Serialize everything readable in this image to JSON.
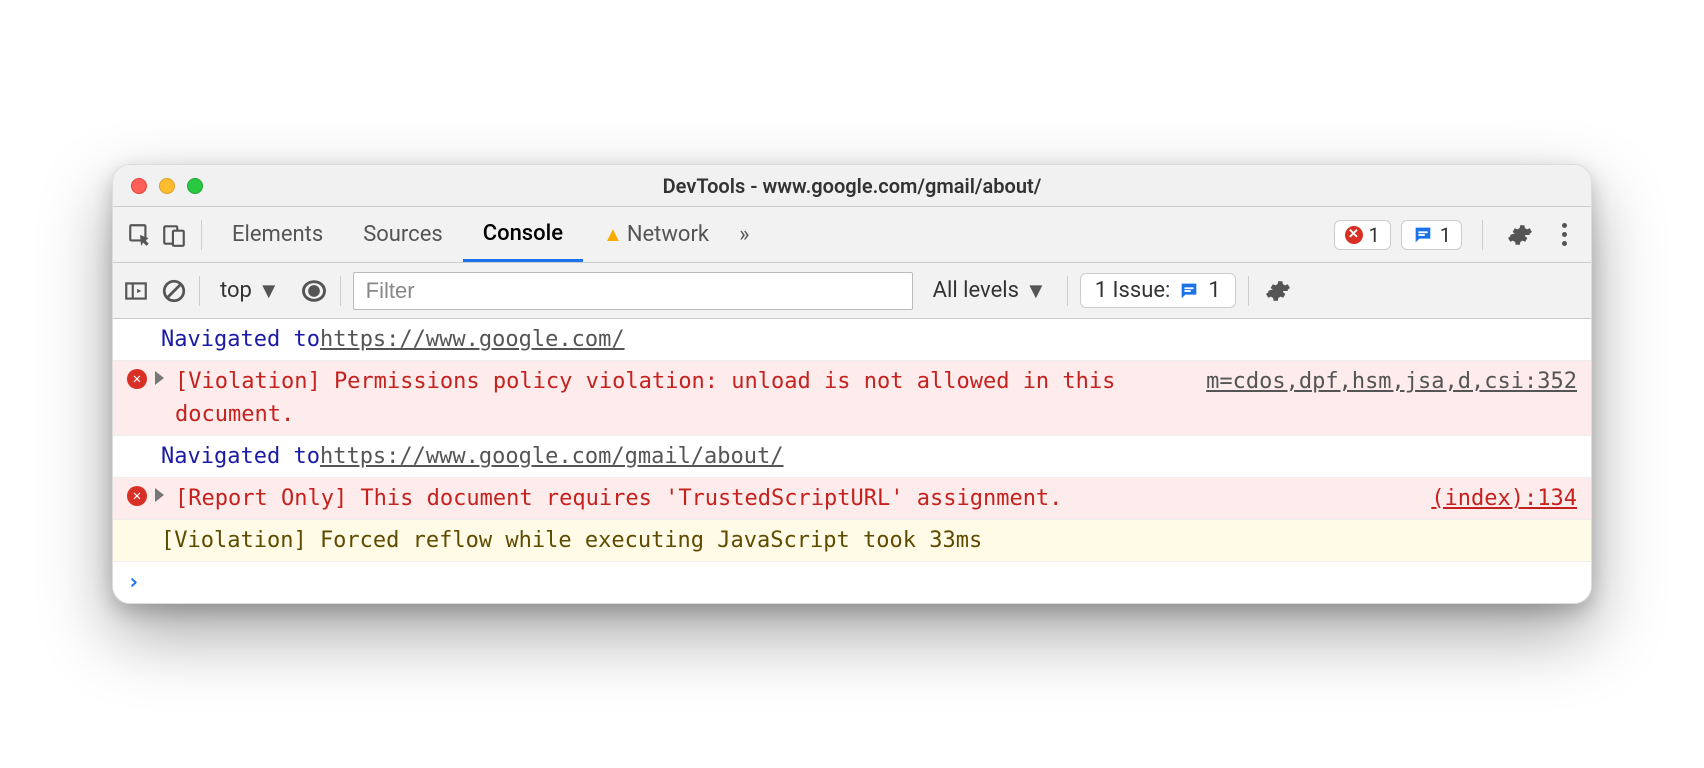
{
  "window": {
    "title": "DevTools - www.google.com/gmail/about/"
  },
  "traffic": {
    "close": "close",
    "min": "minimize",
    "max": "maximize"
  },
  "tabs": {
    "elements": "Elements",
    "sources": "Sources",
    "console": "Console",
    "network": "Network",
    "more": "»"
  },
  "counters": {
    "errors": "1",
    "messages": "1"
  },
  "toolbar": {
    "context": "top",
    "filter_placeholder": "Filter",
    "levels": "All levels",
    "issues_label": "1 Issue:",
    "issues_count": "1"
  },
  "log": [
    {
      "type": "nav",
      "prefix": "Navigated to ",
      "url": "https://www.google.com/"
    },
    {
      "type": "error",
      "text": "[Violation] Permissions policy violation: unload is not allowed in this document.",
      "source": "m=cdos,dpf,hsm,jsa,d,csi:352"
    },
    {
      "type": "nav",
      "prefix": "Navigated to ",
      "url": "https://www.google.com/gmail/about/"
    },
    {
      "type": "error",
      "text": "[Report Only] This document requires 'TrustedScriptURL' assignment.",
      "source": "(index):134"
    },
    {
      "type": "warn",
      "text": "[Violation] Forced reflow while executing JavaScript took 33ms"
    }
  ],
  "prompt": "›"
}
